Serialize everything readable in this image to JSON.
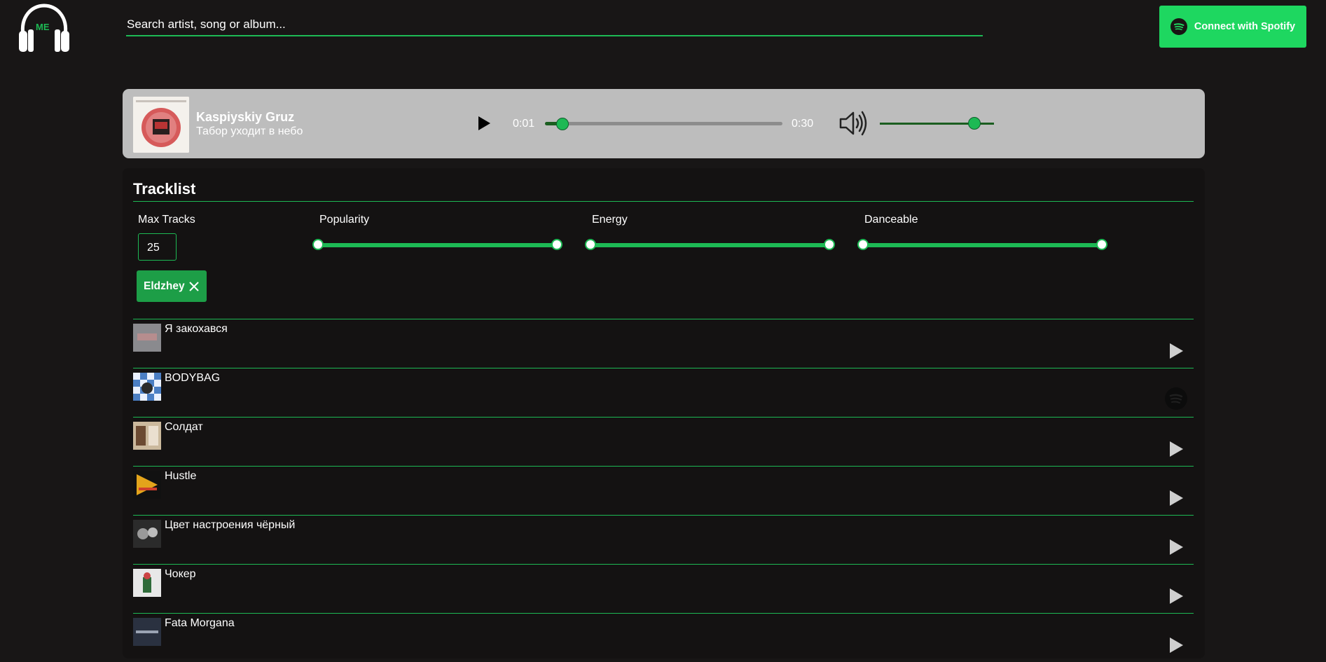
{
  "header": {
    "logo_text": "ME",
    "search_placeholder": "Search artist, song or album...",
    "connect_label": "Connect with Spotify"
  },
  "player": {
    "track_title": "Kaspiyskiy Gruz",
    "track_subtitle": "Табор уходит в небо",
    "current_time": "0:01",
    "end_time": "0:30",
    "progress": 0.07,
    "volume": 0.82
  },
  "tracklist": {
    "heading": "Tracklist",
    "filters": {
      "max_tracks_label": "Max Tracks",
      "max_tracks_value": "25",
      "popularity_label": "Popularity",
      "energy_label": "Energy",
      "danceable_label": "Danceable"
    },
    "artist_chip": "Eldzhey",
    "tracks": [
      {
        "name": "Я закохався",
        "action": "play"
      },
      {
        "name": "BODYBAG",
        "action": "spotify"
      },
      {
        "name": "Солдат",
        "action": "play"
      },
      {
        "name": "Hustle",
        "action": "play"
      },
      {
        "name": "Цвет настроения чёрный",
        "action": "play"
      },
      {
        "name": "Чокер",
        "action": "play"
      },
      {
        "name": "Fata Morgana",
        "action": "play"
      }
    ]
  },
  "colors": {
    "background": "#181616",
    "accent": "#1db954",
    "player_bg": "#bdbdbd",
    "spotify_button": "#1ed760"
  }
}
